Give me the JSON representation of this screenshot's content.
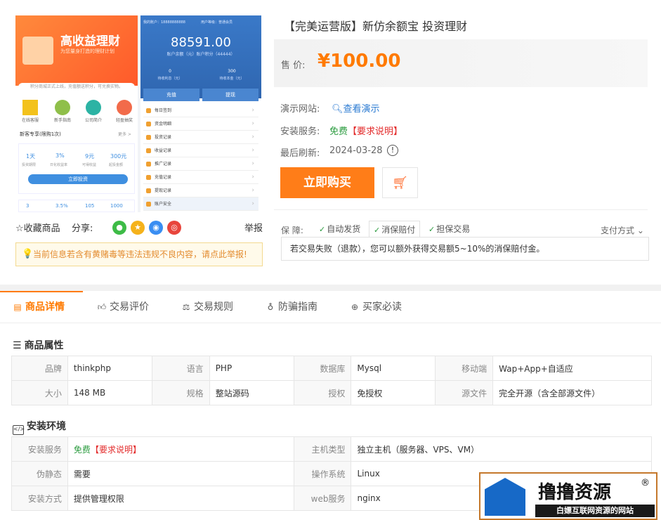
{
  "preview": {
    "banner_title": "高收益理财",
    "banner_sub": "为您量身打造的理财计划",
    "notice": "积分商城正式上线，充值额送积分，可兑换实物。",
    "icons": [
      "在线客服",
      "新手指南",
      "公司简介",
      "轻盈抽奖"
    ],
    "news_title": "新客专享(限购1次)",
    "news_more": "更多 >",
    "stats": [
      "1天",
      "3%",
      "9元",
      "300元"
    ],
    "stats_l": [
      "投资期限",
      "日化收益率",
      "可得收益",
      "起投金额"
    ],
    "invest_btn": "立即投资",
    "top_left": "我的账户：18888888888",
    "top_right": "用户等级：普通会员",
    "amount": "88591.00",
    "amount_sub": "账户余额（元）账户积分（44444）",
    "stat_a": "0",
    "stat_a_l": "待收利息（元）",
    "stat_b": "300",
    "stat_b_l": "待收本金（元）",
    "btn_recharge": "充值",
    "btn_withdraw": "提现",
    "menu": [
      "每日签到",
      "资金明细",
      "投资记录",
      "收益记录",
      "推广记录",
      "充值记录",
      "提现记录",
      "账户安全"
    ],
    "bottom_stats": [
      "3",
      "3.5%",
      "105",
      "1000"
    ]
  },
  "share": {
    "fav": "☆收藏商品",
    "share_label": "分享:",
    "report": "举报"
  },
  "warning": "当前信息若含有黄赌毒等违法违规不良内容，请点此举报!",
  "product": {
    "title": "【完美运营版】新仿余额宝 投资理财",
    "price_label": "售  价:",
    "price": "¥100.00",
    "demo_label": "演示网站:",
    "demo_value": "查看演示",
    "install_label": "安装服务:",
    "install_free": "免费",
    "install_req": "【要求说明】",
    "refresh_label": "最后刷新:",
    "refresh_value": "2024-03-28",
    "buy_btn": "立即购买",
    "guarantee_label": "保  障:",
    "guarantees": [
      "自动发货",
      "消保赔付",
      "担保交易"
    ],
    "pay_method": "支付方式",
    "guarantee_text": "若交易失败（退款），您可以额外获得交易额5~10%的消保赔付金。"
  },
  "tabs": [
    "商品详情",
    "交易评价",
    "交易规则",
    "防骗指南",
    "买家必读"
  ],
  "attrs": {
    "title": "商品属性",
    "rows": [
      [
        [
          "品牌",
          "thinkphp"
        ],
        [
          "语言",
          "PHP"
        ],
        [
          "数据库",
          "Mysql"
        ],
        [
          "移动端",
          "Wap+App+自适应"
        ]
      ],
      [
        [
          "大小",
          "148 MB"
        ],
        [
          "规格",
          "整站源码"
        ],
        [
          "授权",
          "免授权"
        ],
        [
          "源文件",
          "完全开源（含全部源文件）"
        ]
      ]
    ]
  },
  "env": {
    "title": "安装环境",
    "service_label": "安装服务",
    "service_free": "免费",
    "service_req": "【要求说明】",
    "host_label": "主机类型",
    "host_value": "独立主机（服务器、VPS、VM）",
    "rewrite_label": "伪静态",
    "rewrite_value": "需要",
    "os_label": "操作系统",
    "os_value": "Linux",
    "method_label": "安装方式",
    "method_value": "提供管理权限",
    "web_label": "web服务",
    "web_value": "nginx"
  },
  "watermark": {
    "title": "撸撸资源",
    "reg": "®",
    "sub": "白嫖互联网资源的网站"
  },
  "colors": {
    "accent": "#ff7a00",
    "green": "#2a9b3e",
    "red": "#e32b2b"
  }
}
